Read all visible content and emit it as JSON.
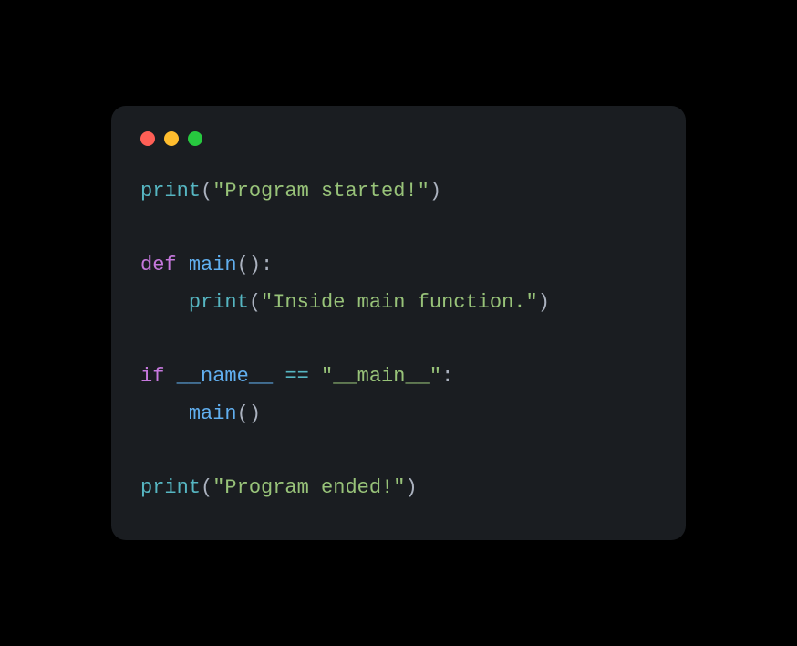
{
  "traffic_lights": {
    "close": "#ff5f56",
    "minimize": "#ffbd2e",
    "maximize": "#27c93f"
  },
  "code": {
    "line1": {
      "fn": "print",
      "open": "(",
      "str": "\"Program started!\"",
      "close": ")"
    },
    "blank1": "",
    "line2": {
      "kw": "def ",
      "name": "main",
      "parens": "():",
      "tail": ""
    },
    "line3": {
      "indent": "    ",
      "fn": "print",
      "open": "(",
      "str": "\"Inside main function.\"",
      "close": ")"
    },
    "blank2": "",
    "line4": {
      "kw": "if ",
      "name1": "__name__",
      "sp1": " ",
      "op": "==",
      "sp2": " ",
      "str": "\"__main__\"",
      "colon": ":"
    },
    "line5": {
      "indent": "    ",
      "name": "main",
      "parens": "()"
    },
    "blank3": "",
    "line6": {
      "fn": "print",
      "open": "(",
      "str": "\"Program ended!\"",
      "close": ")"
    }
  }
}
